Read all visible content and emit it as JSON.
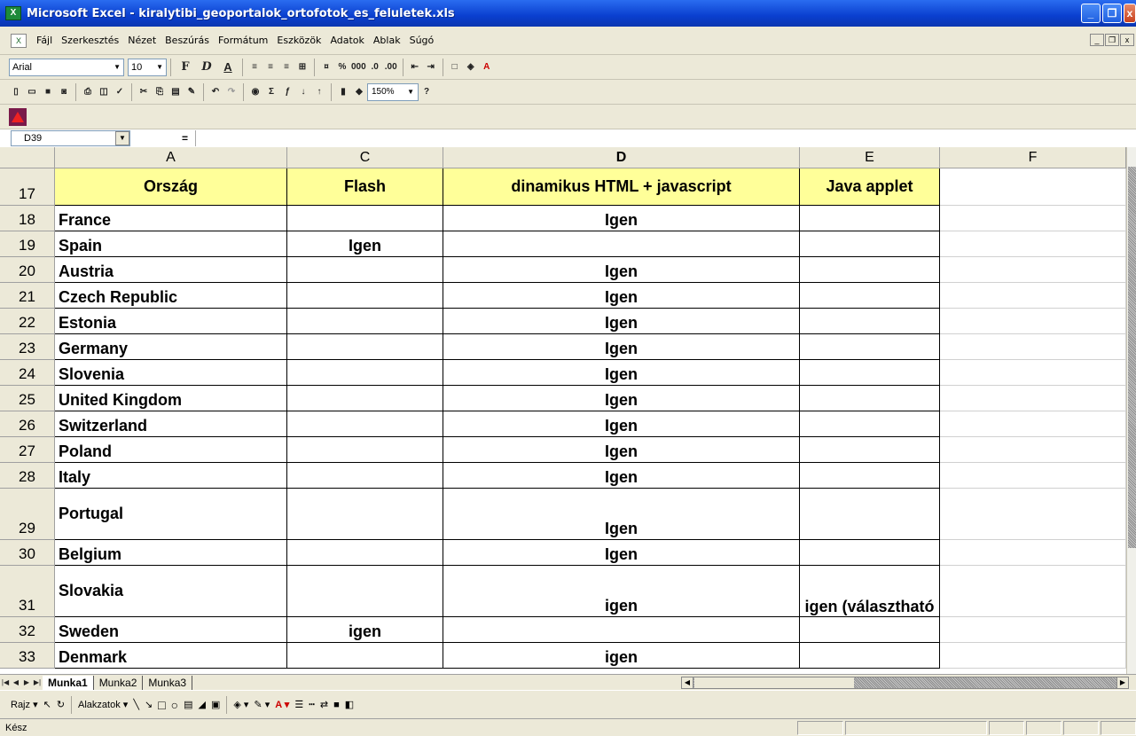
{
  "window": {
    "title": "Microsoft Excel - kiralytibi_geoportalok_ortofotok_es_feluletek.xls"
  },
  "menu": [
    "Fájl",
    "Szerkesztés",
    "Nézet",
    "Beszúrás",
    "Formátum",
    "Eszközök",
    "Adatok",
    "Ablak",
    "Súgó"
  ],
  "formatting_toolbar": {
    "font": "Arial",
    "size": "10",
    "bold": "F",
    "italic": "D",
    "underline": "A"
  },
  "standard_toolbar": {
    "zoom": "150%"
  },
  "formula_bar": {
    "name_box": "D39",
    "equals": "=",
    "value": ""
  },
  "columns": [
    "A",
    "C",
    "D",
    "E",
    "F"
  ],
  "rows": [
    {
      "num": "17",
      "a": "Ország",
      "c": "Flash",
      "d": "dinamikus HTML + javascript",
      "e": "Java applet"
    },
    {
      "num": "18",
      "a": "France",
      "c": "",
      "d": "Igen",
      "e": ""
    },
    {
      "num": "19",
      "a": "Spain",
      "c": "Igen",
      "d": "",
      "e": ""
    },
    {
      "num": "20",
      "a": "Austria",
      "c": "",
      "d": "Igen",
      "e": ""
    },
    {
      "num": "21",
      "a": "Czech Republic",
      "c": "",
      "d": "Igen",
      "e": ""
    },
    {
      "num": "22",
      "a": "Estonia",
      "c": "",
      "d": "Igen",
      "e": ""
    },
    {
      "num": "23",
      "a": "Germany",
      "c": "",
      "d": "Igen",
      "e": ""
    },
    {
      "num": "24",
      "a": "Slovenia",
      "c": "",
      "d": "Igen",
      "e": ""
    },
    {
      "num": "25",
      "a": "United Kingdom",
      "c": "",
      "d": "Igen",
      "e": ""
    },
    {
      "num": "26",
      "a": "Switzerland",
      "c": "",
      "d": "Igen",
      "e": ""
    },
    {
      "num": "27",
      "a": "Poland",
      "c": "",
      "d": "Igen",
      "e": ""
    },
    {
      "num": "28",
      "a": "Italy",
      "c": "",
      "d": "Igen",
      "e": ""
    },
    {
      "num": "29",
      "a": "Portugal",
      "c": "",
      "d": "Igen",
      "e": ""
    },
    {
      "num": "30",
      "a": "Belgium",
      "c": "",
      "d": "Igen",
      "e": ""
    },
    {
      "num": "31",
      "a": "Slovakia",
      "c": "",
      "d": "igen",
      "e": "igen (választható"
    },
    {
      "num": "32",
      "a": "Sweden",
      "c": "igen",
      "d": "",
      "e": ""
    },
    {
      "num": "33",
      "a": "Denmark",
      "c": "",
      "d": "igen",
      "e": ""
    }
  ],
  "sheets": [
    "Munka1",
    "Munka2",
    "Munka3"
  ],
  "draw_toolbar": {
    "draw": "Rajz",
    "autoshapes": "Alakzatok"
  },
  "status": {
    "text": "Kész"
  },
  "colors": {
    "header_fill": "#ffff99",
    "titlebar": "#0a3fcf"
  }
}
